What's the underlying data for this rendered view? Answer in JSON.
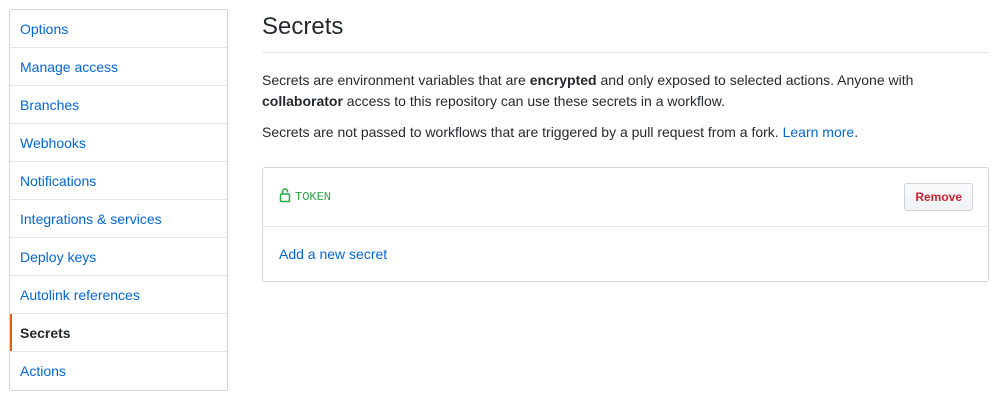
{
  "sidebar": {
    "items": [
      {
        "label": "Options"
      },
      {
        "label": "Manage access"
      },
      {
        "label": "Branches"
      },
      {
        "label": "Webhooks"
      },
      {
        "label": "Notifications"
      },
      {
        "label": "Integrations & services"
      },
      {
        "label": "Deploy keys"
      },
      {
        "label": "Autolink references"
      },
      {
        "label": "Secrets",
        "selected": true
      },
      {
        "label": "Actions"
      }
    ]
  },
  "main": {
    "title": "Secrets",
    "description": {
      "part1": "Secrets are environment variables that are ",
      "bold1": "encrypted",
      "part2": " and only exposed to selected actions. Anyone with ",
      "bold2": "collaborator",
      "part3": " access to this repository can use these secrets in a workflow."
    },
    "fork_note": {
      "text": "Secrets are not passed to workflows that are triggered by a pull request from a fork. ",
      "link": "Learn more",
      "end": "."
    },
    "secrets": [
      {
        "name": "TOKEN",
        "icon": "lock-icon",
        "remove_label": "Remove"
      }
    ],
    "add_secret_label": "Add a new secret"
  },
  "colors": {
    "link": "#0366d6",
    "selected_indicator": "#e36209",
    "secret_name": "#28a745",
    "remove_text": "#cb2431"
  }
}
